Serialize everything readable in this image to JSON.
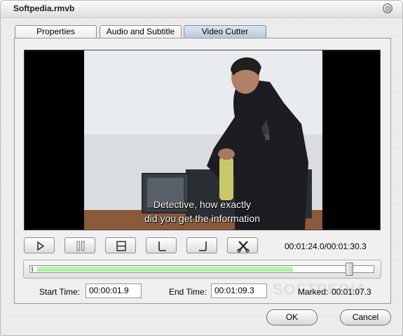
{
  "window": {
    "title": "Softpedia.rmvb"
  },
  "tabs": [
    {
      "label": "Properties",
      "active": false
    },
    {
      "label": "Audio and Subtitle",
      "active": false
    },
    {
      "label": "Video Cutter",
      "active": true
    }
  ],
  "video": {
    "subtitle_line1": "Detective, how exactly",
    "subtitle_line2": "did you get the information"
  },
  "controls": {
    "buttons": [
      {
        "name": "play-button",
        "icon": "play-icon"
      },
      {
        "name": "pause-button",
        "icon": "pause-icon"
      },
      {
        "name": "stop-button",
        "icon": "stop-icon"
      },
      {
        "name": "mark-start-button",
        "icon": "mark-start-icon"
      },
      {
        "name": "mark-end-button",
        "icon": "mark-end-icon"
      },
      {
        "name": "cut-button",
        "icon": "scissors-icon"
      }
    ],
    "time_readout": "00:01:24.0/00:01:30.3"
  },
  "slider": {
    "marked_start_fraction": 0.021,
    "marked_end_fraction": 0.765,
    "position_fraction": 0.93,
    "fill_color": "#a4ec9e"
  },
  "fields": {
    "start_label": "Start Time:",
    "start_value": "00:00:01.9",
    "end_label": "End Time:",
    "end_value": "00:01:09.3",
    "marked_label": "Marked:",
    "marked_value": "00:01:07.3"
  },
  "watermark": "SOFTPEDIA",
  "buttons": {
    "ok": "OK",
    "cancel": "Cancel"
  }
}
